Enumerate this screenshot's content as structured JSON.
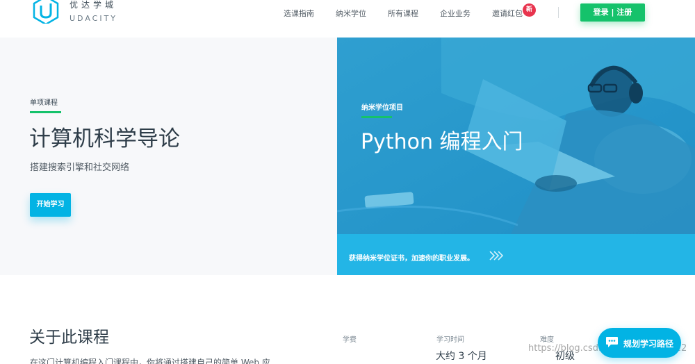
{
  "header": {
    "logo_cn": "优达学城",
    "logo_en": "UDACITY",
    "nav": [
      "选课指南",
      "纳米学位",
      "所有课程",
      "企业业务",
      "邀请红包"
    ],
    "badge": "新",
    "login": "登录 | 注册"
  },
  "hero_left": {
    "course_type": "单项课程",
    "title": "计算机科学导论",
    "subtitle": "搭建搜索引擎和社交网络",
    "cta": "开始学习"
  },
  "hero_right": {
    "label": "纳米学位项目",
    "title": "Python 编程入门",
    "cert": "获得纳米学位证书，加速你的职业发展。"
  },
  "about": {
    "title": "关于此课程",
    "text": "在这门计算机编程入门课程中，你将通过搭建自己的简单 Web 应",
    "meta": [
      {
        "label": "学费",
        "value": ""
      },
      {
        "label": "学习时间",
        "value": "大约 3 个月"
      },
      {
        "label": "难度",
        "value": "初级"
      }
    ]
  },
  "floating": {
    "label": "规划学习路径"
  },
  "watermark": "https://blog.csdn.net/qq_39363022",
  "colors": {
    "green": "#15c26b",
    "blue": "#02b3e4",
    "badge_red": "#e8344e"
  }
}
